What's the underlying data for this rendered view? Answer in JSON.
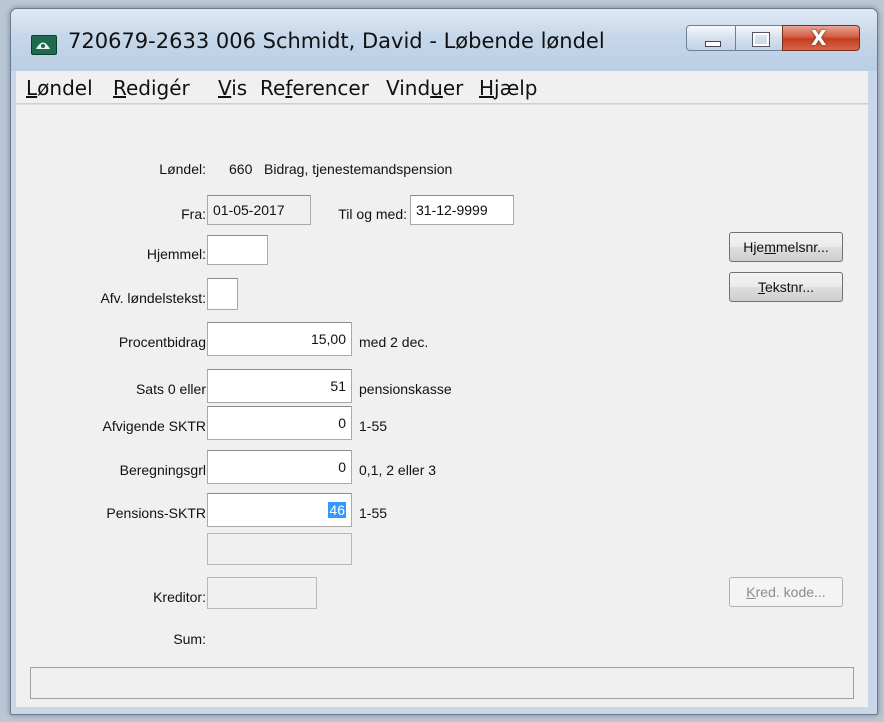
{
  "window": {
    "title": "720679-2633 006 Schmidt, David - Løbende løndel",
    "close_glyph": "X"
  },
  "menu": [
    {
      "pre": "",
      "ul": "L",
      "post": "øndel"
    },
    {
      "pre": "",
      "ul": "R",
      "post": "edigér"
    },
    {
      "pre": "",
      "ul": "V",
      "post": "is"
    },
    {
      "pre": "Re",
      "ul": "f",
      "post": "erencer"
    },
    {
      "pre": "Vind",
      "ul": "u",
      "post": "er"
    },
    {
      "pre": "",
      "ul": "H",
      "post": "jælp"
    }
  ],
  "form": {
    "londel_label": "Løndel:",
    "londel_code": "660",
    "londel_name": "Bidrag, tjenestemandspension",
    "fra_label": "Fra:",
    "fra_value": "01-05-2017",
    "tilogmed_label": "Til og med:",
    "tilogmed_value": "31-12-9999",
    "hjemmel_label": "Hjemmel:",
    "hjemmel_value": "",
    "afv_label": "Afv. løndelstekst:",
    "afv_value": "",
    "rows": [
      {
        "label": "Procentbidrag",
        "value": "15,00",
        "hint": "med 2 dec."
      },
      {
        "label": "Sats 0 eller",
        "value": "51",
        "hint": "pensionskasse"
      },
      {
        "label": "Afvigende SKTR",
        "value": "0",
        "hint": "1-55"
      },
      {
        "label": "Beregningsgrl",
        "value": "0",
        "hint": "0,1, 2 eller 3"
      },
      {
        "label": "Pensions-SKTR",
        "value": "46",
        "hint": "1-55"
      }
    ],
    "empty_field_value": "",
    "kreditor_label": "Kreditor:",
    "kreditor_value": "",
    "sum_label": "Sum:",
    "sum_value": ""
  },
  "buttons": {
    "hjemmelsnr": {
      "pre": "Hje",
      "ul": "m",
      "post": "melsnr..."
    },
    "tekstnr": {
      "pre": "",
      "ul": "T",
      "post": "ekstnr..."
    },
    "kredkode": {
      "pre": "",
      "ul": "K",
      "post": "red. kode..."
    }
  },
  "status": {
    "text": ""
  }
}
